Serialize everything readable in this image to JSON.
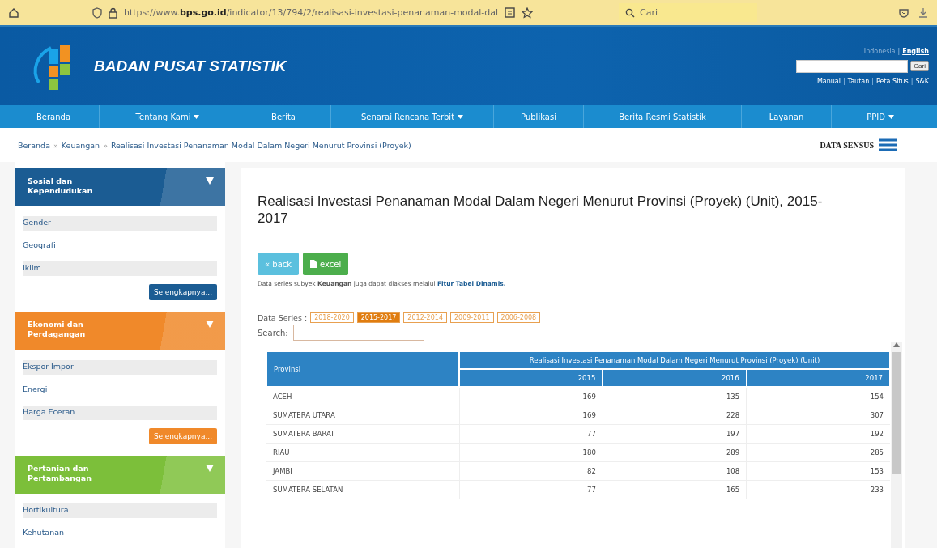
{
  "browser": {
    "url_host": "https://www.bps.go.id",
    "url_path": "/indicator/13/794/2/realisasi-investasi-penanaman-modal-dal",
    "search_placeholder": "Cari"
  },
  "header": {
    "site_name": "BADAN PUSAT STATISTIK",
    "languages": [
      {
        "label": "Indonesia",
        "selected": true,
        "kind": "link"
      },
      {
        "label": "|",
        "kind": "separator"
      },
      {
        "label": "English",
        "selected": false,
        "kind": "link"
      }
    ],
    "search_button": "Cari",
    "links": [
      {
        "label": "Manual",
        "kind": "link"
      },
      {
        "label": "|",
        "kind": "separator"
      },
      {
        "label": "Tautan",
        "kind": "link"
      },
      {
        "label": "|",
        "kind": "separator"
      },
      {
        "label": "Peta Situs",
        "kind": "link"
      },
      {
        "label": "|",
        "kind": "separator"
      },
      {
        "label": "S&K",
        "kind": "link"
      }
    ]
  },
  "nav": [
    {
      "label": "Beranda",
      "dropdown": false
    },
    {
      "label": "Tentang Kami",
      "dropdown": true
    },
    {
      "label": "Berita",
      "dropdown": false
    },
    {
      "label": "Senarai Rencana Terbit",
      "dropdown": true
    },
    {
      "label": "Publikasi",
      "dropdown": false
    },
    {
      "label": "Berita Resmi Statistik",
      "dropdown": false
    },
    {
      "label": "Layanan",
      "dropdown": false
    },
    {
      "label": "PPID",
      "dropdown": true
    }
  ],
  "breadcrumb": [
    {
      "label": "Beranda",
      "kind": "link"
    },
    {
      "label": "»",
      "kind": "separator"
    },
    {
      "label": "Keuangan",
      "kind": "link"
    },
    {
      "label": "»",
      "kind": "separator"
    },
    {
      "label": "Realisasi Investasi Penanaman Modal Dalam Negeri Menurut Provinsi (Proyek)",
      "kind": "link"
    }
  ],
  "data_sensus": "DATA SENSUS",
  "sidebar": [
    {
      "title": "Sosial dan Kependudukan",
      "color": "#1b5c93",
      "items": [
        "Gender",
        "Geografi",
        "Iklim"
      ],
      "more": "Selengkapnya..."
    },
    {
      "title": "Ekonomi dan Perdagangan",
      "color": "#f0892a",
      "items": [
        "Ekspor-Impor",
        "Energi",
        "Harga Eceran"
      ],
      "more": "Selengkapnya..."
    },
    {
      "title": "Pertanian dan Pertambangan",
      "color": "#7cbf3a",
      "items": [
        "Hortikultura",
        "Kehutanan"
      ]
    }
  ],
  "main": {
    "title": "Realisasi Investasi Penanaman Modal Dalam Negeri Menurut Provinsi (Proyek) (Unit), 2015-2017",
    "buttons": [
      {
        "label": "« back",
        "kind": "back"
      },
      {
        "label": "excel",
        "kind": "excel"
      }
    ],
    "note": "Data series subyek **Keuangan** juga dapat diakses melalui ",
    "note_link": "Fitur Tabel Dinamis.",
    "series_label": "Data Series :",
    "series": [
      {
        "label": "2018-2020",
        "selected": false
      },
      {
        "label": "2015-2017",
        "selected": true
      },
      {
        "label": "2012-2014",
        "selected": false
      },
      {
        "label": "2009-2011",
        "selected": false
      },
      {
        "label": "2006-2008",
        "selected": false
      }
    ],
    "search_label": "Search:",
    "table": {
      "first_column": "Provinsi",
      "group_header": "Realisasi Investasi Penanaman Modal Dalam Negeri Menurut Provinsi (Proyek) (Unit)",
      "years": [
        "2015",
        "2016",
        "2017"
      ],
      "rows": [
        {
          "province": "ACEH",
          "values": [
            "169",
            "135",
            "154"
          ]
        },
        {
          "province": "SUMATERA UTARA",
          "values": [
            "169",
            "228",
            "307"
          ]
        },
        {
          "province": "SUMATERA BARAT",
          "values": [
            "77",
            "197",
            "192"
          ]
        },
        {
          "province": "RIAU",
          "values": [
            "180",
            "289",
            "285"
          ]
        },
        {
          "province": "JAMBI",
          "values": [
            "82",
            "108",
            "153"
          ]
        },
        {
          "province": "SUMATERA SELATAN",
          "values": [
            "77",
            "165",
            "233"
          ]
        }
      ]
    }
  }
}
